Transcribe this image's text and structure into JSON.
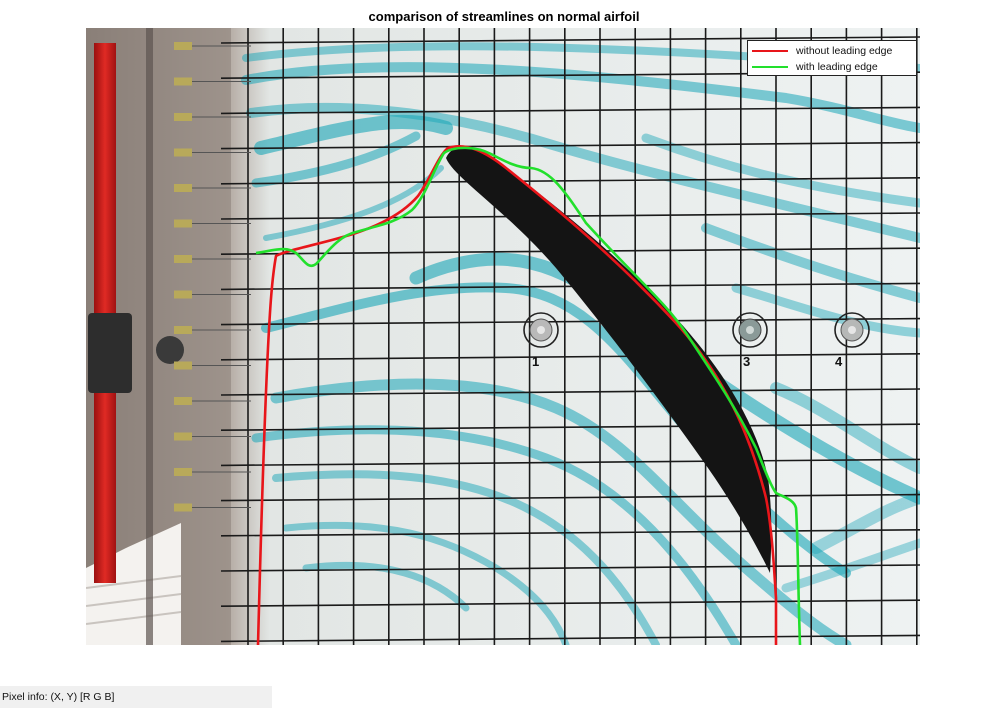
{
  "title": "comparison of streamlines on normal airfoil",
  "legend": {
    "items": [
      {
        "label": "without leading edge",
        "color": "#e8151a"
      },
      {
        "label": "with leading edge",
        "color": "#22e02c"
      }
    ]
  },
  "markers": [
    "1",
    "3",
    "4"
  ],
  "status_bar": {
    "text": "Pixel info: (X, Y)  [R G B]"
  },
  "colors": {
    "dye": "#1aa6b8",
    "airfoil": "#141414",
    "grid": "#1a1a1a",
    "rail": "#d21b1b"
  }
}
